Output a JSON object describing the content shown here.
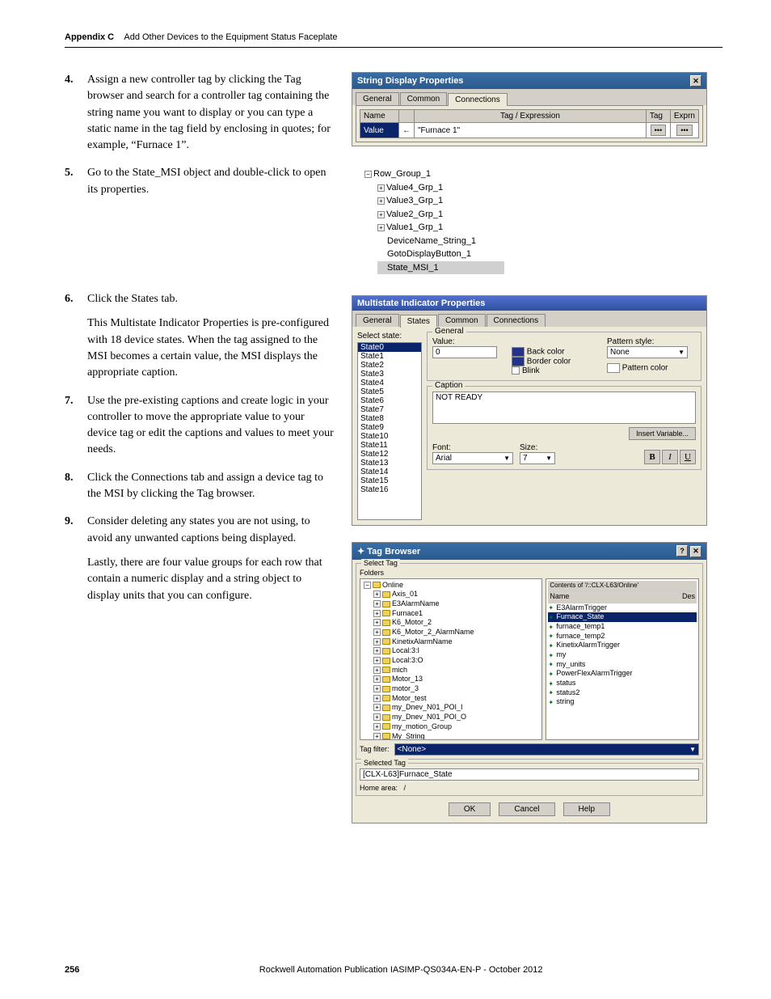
{
  "header": {
    "appendix": "Appendix C",
    "title": "Add Other Devices to the Equipment Status Faceplate"
  },
  "steps": [
    {
      "n": "4.",
      "paras": [
        "Assign a new controller tag by clicking the Tag browser and search for a controller tag containing the string name you want to display or you can type a static name in the tag field by enclosing in quotes; for example, “Furnace 1”."
      ]
    },
    {
      "n": "5.",
      "paras": [
        "Go to the State_MSI object and double-click to open its properties."
      ]
    },
    {
      "n": "6.",
      "paras": [
        "Click the States tab.",
        "This Multistate Indicator Properties is pre-configured with 18 device states. When the tag assigned to the MSI becomes a certain value, the MSI displays the appropriate caption."
      ]
    },
    {
      "n": "7.",
      "paras": [
        "Use the pre-existing captions and create logic in your controller to move the appropriate value to your device tag or edit the captions and values to meet your needs."
      ]
    },
    {
      "n": "8.",
      "paras": [
        "Click the Connections tab and assign a device tag to the MSI by clicking the Tag browser."
      ]
    },
    {
      "n": "9.",
      "paras": [
        "Consider deleting any states you are not using, to avoid any unwanted captions being displayed.",
        "Lastly, there are four value groups for each row that contain a numeric display and a string object to display units that you can configure."
      ]
    }
  ],
  "sdp": {
    "title": "String Display Properties",
    "tabs": [
      "General",
      "Common",
      "Connections"
    ],
    "cols": {
      "name": "Name",
      "tagexp": "Tag / Expression",
      "tag": "Tag",
      "exprn": "Exprn"
    },
    "row": {
      "name": "Value",
      "arrow": "←",
      "value": "\"Furnace 1\"",
      "dot1": "•••",
      "dot2": "•••"
    }
  },
  "tree": {
    "root": "Row_Group_1",
    "children": [
      "Value4_Grp_1",
      "Value3_Grp_1",
      "Value2_Grp_1",
      "Value1_Grp_1",
      "DeviceName_String_1",
      "GotoDisplayButton_1",
      "State_MSI_1"
    ]
  },
  "msi": {
    "title": "Multistate Indicator Properties",
    "tabs": [
      "General",
      "States",
      "Common",
      "Connections"
    ],
    "selectLabel": "Select state:",
    "states": [
      "State0",
      "State1",
      "State2",
      "State3",
      "State4",
      "State5",
      "State6",
      "State7",
      "State8",
      "State9",
      "State10",
      "State11",
      "State12",
      "State13",
      "State14",
      "State15",
      "State16"
    ],
    "general": {
      "legend": "General",
      "valueLabel": "Value:",
      "value": "0",
      "backcolor": "Back color",
      "backswatch": "#223388",
      "bordercolor": "Border color",
      "borderswatch": "#223388",
      "blink": "Blink",
      "patternstyle": "Pattern style:",
      "patternval": "None",
      "patterncolor": "Pattern color",
      "patternswatch": "#ffffff"
    },
    "caption": {
      "legend": "Caption",
      "text": "NOT READY",
      "insert": "Insert Variable...",
      "fontLabel": "Font:",
      "font": "Arial",
      "sizeLabel": "Size:",
      "size": "7",
      "b": "B",
      "i": "I",
      "u": "U"
    }
  },
  "tb": {
    "title": "Tag Browser",
    "selectLegend": "Select Tag",
    "foldersLabel": "Folders",
    "contentsLabel": "Contents of '/::CLX-L63/Online'",
    "nameHdr": "Name",
    "desHdr": "Des",
    "folders": [
      "Online",
      "Axis_01",
      "E3AlarmName",
      "Furnace1",
      "K6_Motor_2",
      "K6_Motor_2_AlarmName",
      "KinetixAlarmName",
      "Local:3:I",
      "Local:3:O",
      "mich",
      "Motor_13",
      "motor_3",
      "Motor_test",
      "my_Dnev_N01_POI_I",
      "my_Dnev_N01_POI_O",
      "my_motion_Group",
      "My_String"
    ],
    "tags": [
      "E3AlarmTrigger",
      "Furnace_State",
      "furnace_temp1",
      "furnace_temp2",
      "KinetixAlarmTrigger",
      "my",
      "my_units",
      "PowerFlexAlarmTrigger",
      "status",
      "status2",
      "string"
    ],
    "tagfilterLabel": "Tag filter:",
    "tagfilter": "<None>",
    "selectedLegend": "Selected Tag",
    "selected": "[CLX-L63]Furnace_State",
    "homeLabel": "Home area:",
    "home": "/",
    "ok": "OK",
    "cancel": "Cancel",
    "help": "Help"
  },
  "footer": {
    "page": "256",
    "pub": "Rockwell Automation Publication IASIMP-QS034A-EN-P - October 2012"
  }
}
